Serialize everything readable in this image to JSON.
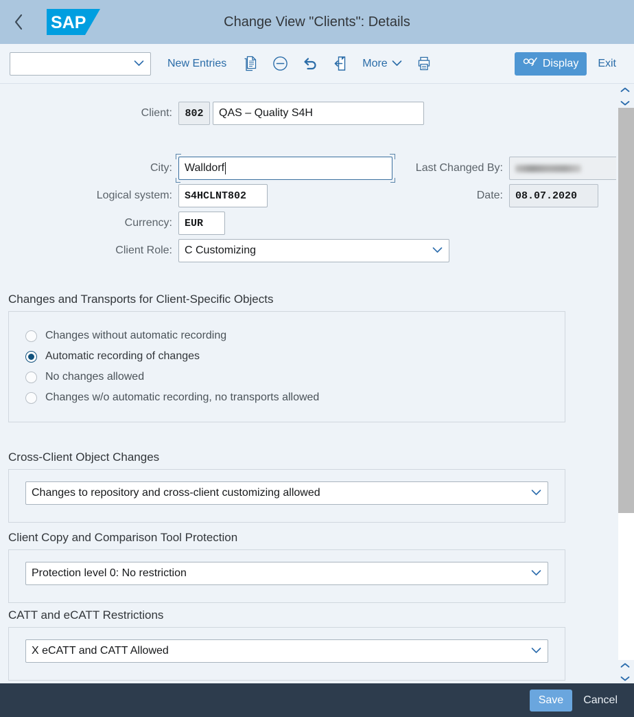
{
  "header": {
    "back_icon": "chevron-left-icon",
    "logo_text": "SAP",
    "title": "Change View \"Clients\": Details"
  },
  "toolbar": {
    "variant_select_value": "",
    "variant_select_placeholder": "",
    "new_entries_label": "New Entries",
    "icons": [
      {
        "name": "copy-icon",
        "title": "Copy As"
      },
      {
        "name": "delete-icon",
        "title": "Delete"
      },
      {
        "name": "undo-icon",
        "title": "Undo"
      },
      {
        "name": "back-entry-icon",
        "title": "Back"
      }
    ],
    "more_label": "More",
    "print_icon": "print-icon",
    "display_label": "Display",
    "display_icon": "display-change-icon",
    "exit_label": "Exit"
  },
  "form": {
    "client_label": "Client:",
    "client_id": "802",
    "client_name": "QAS – Quality S4H",
    "city_label": "City:",
    "city_value": "Walldorf",
    "logical_system_label": "Logical system:",
    "logical_system_value": "S4HCLNT802",
    "currency_label": "Currency:",
    "currency_value": "EUR",
    "client_role_label": "Client Role:",
    "client_role_value": "C Customizing",
    "last_changed_by_label": "Last Changed By:",
    "last_changed_by_value": "",
    "date_label": "Date:",
    "date_value": "08.07.2020"
  },
  "sections": {
    "changes_transports": {
      "title": "Changes and Transports for Client-Specific Objects",
      "options": [
        {
          "label": "Changes without automatic recording",
          "selected": false
        },
        {
          "label": "Automatic recording of changes",
          "selected": true
        },
        {
          "label": "No changes allowed",
          "selected": false
        },
        {
          "label": "Changes w/o automatic recording, no transports allowed",
          "selected": false
        }
      ]
    },
    "cross_client": {
      "title": "Cross-Client Object Changes",
      "value": "Changes to repository and cross-client customizing allowed"
    },
    "client_copy": {
      "title": "Client Copy and Comparison Tool Protection",
      "value": "Protection level 0: No restriction"
    },
    "catt": {
      "title": "CATT and eCATT Restrictions",
      "value": "X eCATT and CATT Allowed"
    }
  },
  "scrollbar": {
    "up_icon": "chevron-up-icon",
    "down_icon": "chevron-down-icon"
  },
  "footer": {
    "save_label": "Save",
    "cancel_label": "Cancel"
  },
  "colors": {
    "shell_header_bg": "#abc6de",
    "page_bg": "#eef3f8",
    "accent_blue": "#2a6ca8",
    "display_button_bg": "#4e96d3",
    "footer_bg": "#2d3c4d",
    "save_button_bg": "#6aa6de",
    "radio_selected": "#11527d",
    "sap_logo_blue": "#009ee0"
  }
}
